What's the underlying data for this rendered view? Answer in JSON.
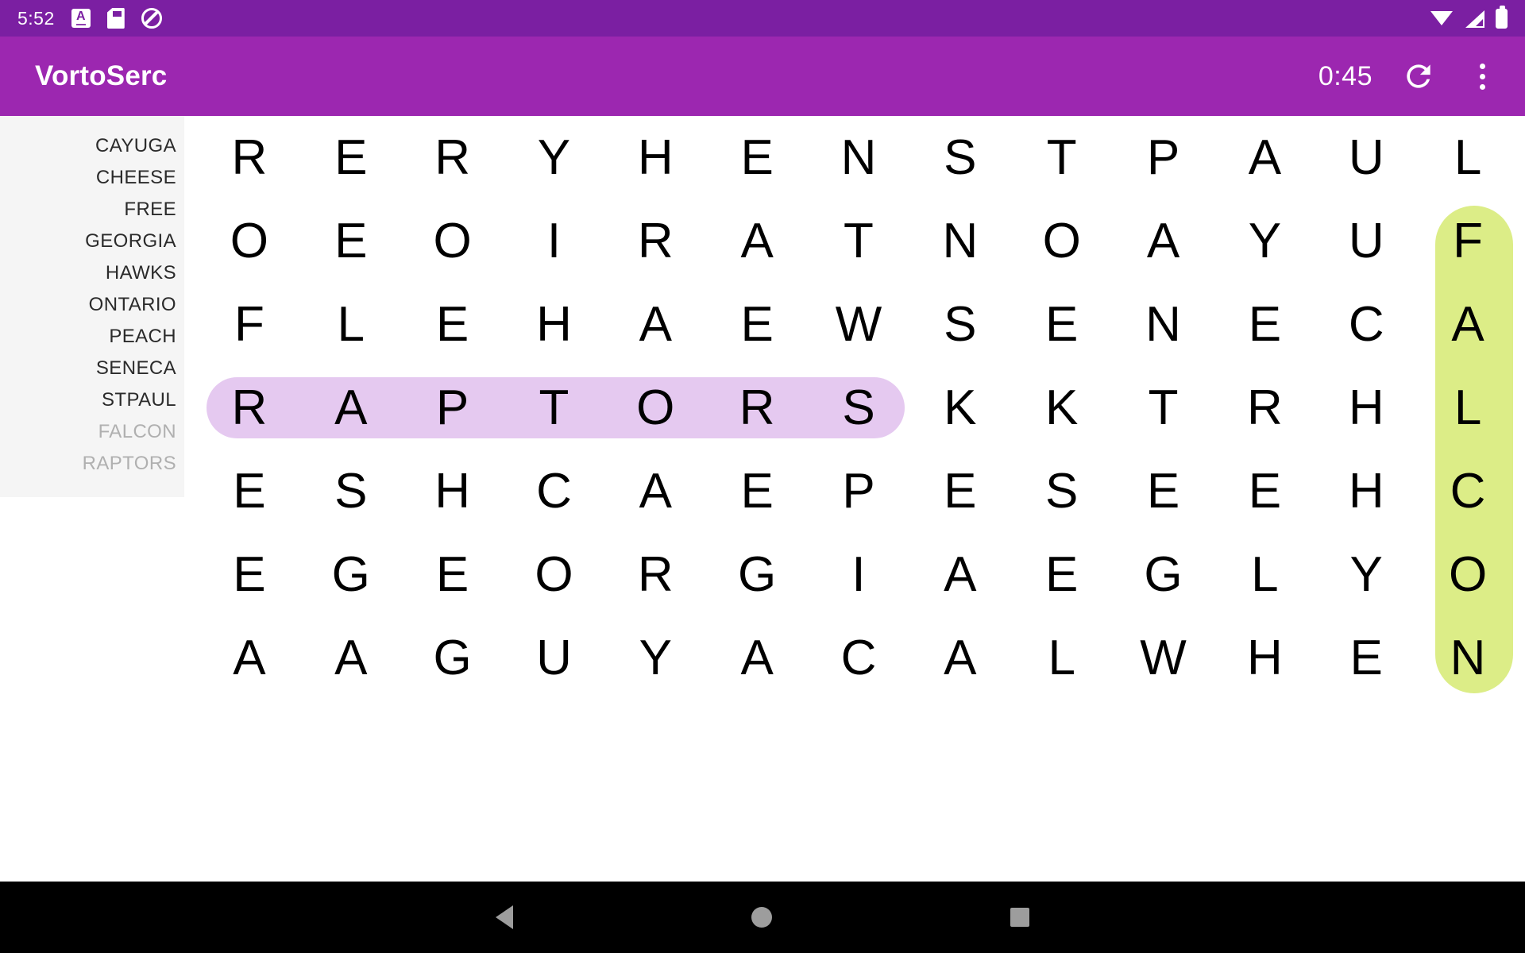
{
  "statusbar": {
    "clock": "5:52",
    "left_icons": [
      "screenshot-a-icon",
      "sd-card-icon",
      "do-not-disturb-icon"
    ],
    "right_icons": [
      "wifi-icon",
      "cell-signal-icon",
      "battery-icon"
    ]
  },
  "appbar": {
    "title": "VortoSerc",
    "timer": "0:45",
    "refresh_label": "refresh-icon",
    "overflow_label": "more-options-icon"
  },
  "wordlist": [
    {
      "label": "CAYUGA",
      "found": false
    },
    {
      "label": "CHEESE",
      "found": false
    },
    {
      "label": "FREE",
      "found": false
    },
    {
      "label": "GEORGIA",
      "found": false
    },
    {
      "label": "HAWKS",
      "found": false
    },
    {
      "label": "ONTARIO",
      "found": false
    },
    {
      "label": "PEACH",
      "found": false
    },
    {
      "label": "SENECA",
      "found": false
    },
    {
      "label": "STPAUL",
      "found": false
    },
    {
      "label": "FALCON",
      "found": true
    },
    {
      "label": "RAPTORS",
      "found": true
    }
  ],
  "grid": {
    "rows": 7,
    "cols": 13,
    "letters": [
      [
        "R",
        "E",
        "R",
        "Y",
        "H",
        "E",
        "N",
        "S",
        "T",
        "P",
        "A",
        "U",
        "L"
      ],
      [
        "O",
        "E",
        "O",
        "I",
        "R",
        "A",
        "T",
        "N",
        "O",
        "A",
        "Y",
        "U",
        "F"
      ],
      [
        "F",
        "L",
        "E",
        "H",
        "A",
        "E",
        "W",
        "S",
        "E",
        "N",
        "E",
        "C",
        "A"
      ],
      [
        "R",
        "A",
        "P",
        "T",
        "O",
        "R",
        "S",
        "K",
        "K",
        "T",
        "R",
        "H",
        "L"
      ],
      [
        "E",
        "S",
        "H",
        "C",
        "A",
        "E",
        "P",
        "E",
        "S",
        "E",
        "E",
        "H",
        "C"
      ],
      [
        "E",
        "G",
        "E",
        "O",
        "R",
        "G",
        "I",
        "A",
        "E",
        "G",
        "L",
        "Y",
        "O"
      ],
      [
        "A",
        "A",
        "G",
        "U",
        "Y",
        "A",
        "C",
        "A",
        "L",
        "W",
        "H",
        "E",
        "N"
      ]
    ],
    "highlights": [
      {
        "word": "RAPTORS",
        "color": "#e5c9f0",
        "orientation": "horizontal",
        "row": 3,
        "col_start": 0,
        "col_end": 6
      },
      {
        "word": "FALCON",
        "color": "#dced87",
        "orientation": "vertical",
        "col": 12,
        "row_start": 1,
        "row_end": 6
      }
    ]
  },
  "navbar": {
    "back": "back-nav-icon",
    "home": "home-nav-icon",
    "recent": "recent-apps-nav-icon"
  },
  "colors": {
    "statusbar": "#7b1fa2",
    "appbar": "#9c27b0",
    "found_word": "#b0b0b0",
    "raptors_highlight": "#e5c9f0",
    "falcon_highlight": "#dced87"
  }
}
